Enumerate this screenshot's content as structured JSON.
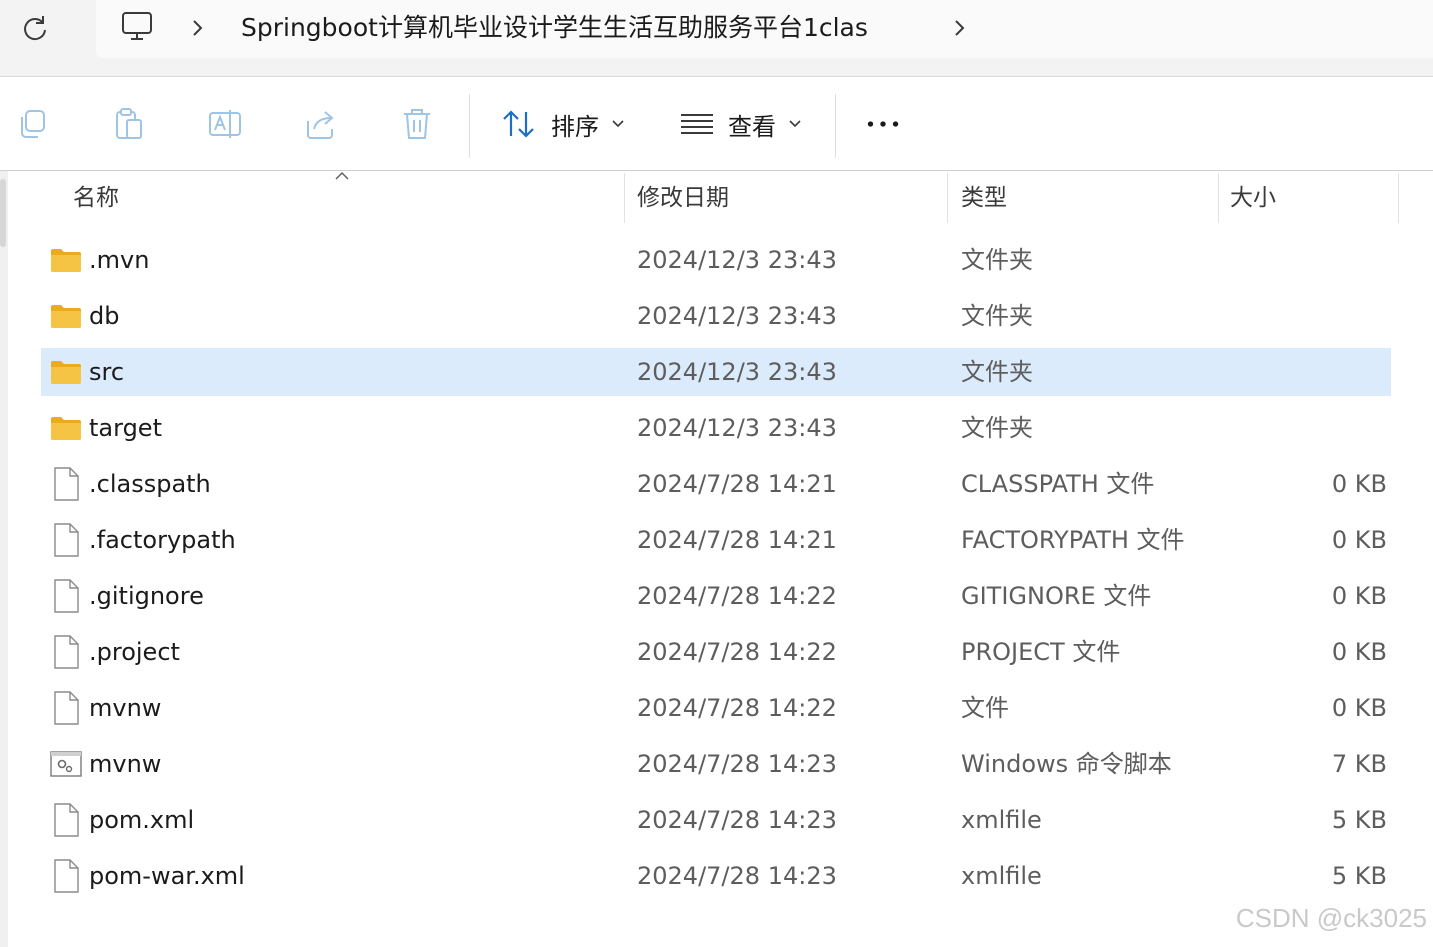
{
  "breadcrumb": {
    "path_text": "Springboot计算机毕业设计学生生活互助服务平台1clas"
  },
  "toolbar": {
    "sort_label": "排序",
    "view_label": "查看"
  },
  "columns": {
    "name": "名称",
    "modified": "修改日期",
    "type": "类型",
    "size": "大小"
  },
  "files": [
    {
      "name": ".mvn",
      "modified": "2024/12/3 23:43",
      "type": "文件夹",
      "size": "",
      "icon": "folder-icon"
    },
    {
      "name": "db",
      "modified": "2024/12/3 23:43",
      "type": "文件夹",
      "size": "",
      "icon": "folder-icon"
    },
    {
      "name": "src",
      "modified": "2024/12/3 23:43",
      "type": "文件夹",
      "size": "",
      "icon": "folder-icon",
      "selected": true
    },
    {
      "name": "target",
      "modified": "2024/12/3 23:43",
      "type": "文件夹",
      "size": "",
      "icon": "folder-icon"
    },
    {
      "name": ".classpath",
      "modified": "2024/7/28 14:21",
      "type": "CLASSPATH 文件",
      "size": "0 KB",
      "icon": "file-icon"
    },
    {
      "name": ".factorypath",
      "modified": "2024/7/28 14:21",
      "type": "FACTORYPATH 文件",
      "size": "0 KB",
      "icon": "file-icon"
    },
    {
      "name": ".gitignore",
      "modified": "2024/7/28 14:22",
      "type": "GITIGNORE 文件",
      "size": "0 KB",
      "icon": "file-icon"
    },
    {
      "name": ".project",
      "modified": "2024/7/28 14:22",
      "type": "PROJECT 文件",
      "size": "0 KB",
      "icon": "file-icon"
    },
    {
      "name": "mvnw",
      "modified": "2024/7/28 14:22",
      "type": "文件",
      "size": "0 KB",
      "icon": "file-icon"
    },
    {
      "name": "mvnw",
      "modified": "2024/7/28 14:23",
      "type": "Windows 命令脚本",
      "size": "7 KB",
      "icon": "script-icon"
    },
    {
      "name": "pom.xml",
      "modified": "2024/7/28 14:23",
      "type": "xmlfile",
      "size": "5 KB",
      "icon": "file-icon"
    },
    {
      "name": "pom-war.xml",
      "modified": "2024/7/28 14:23",
      "type": "xmlfile",
      "size": "5 KB",
      "icon": "file-icon"
    }
  ],
  "colors": {
    "selection": "#dcebfb",
    "folder": "#f6c445"
  },
  "watermark": "CSDN @ck3025"
}
